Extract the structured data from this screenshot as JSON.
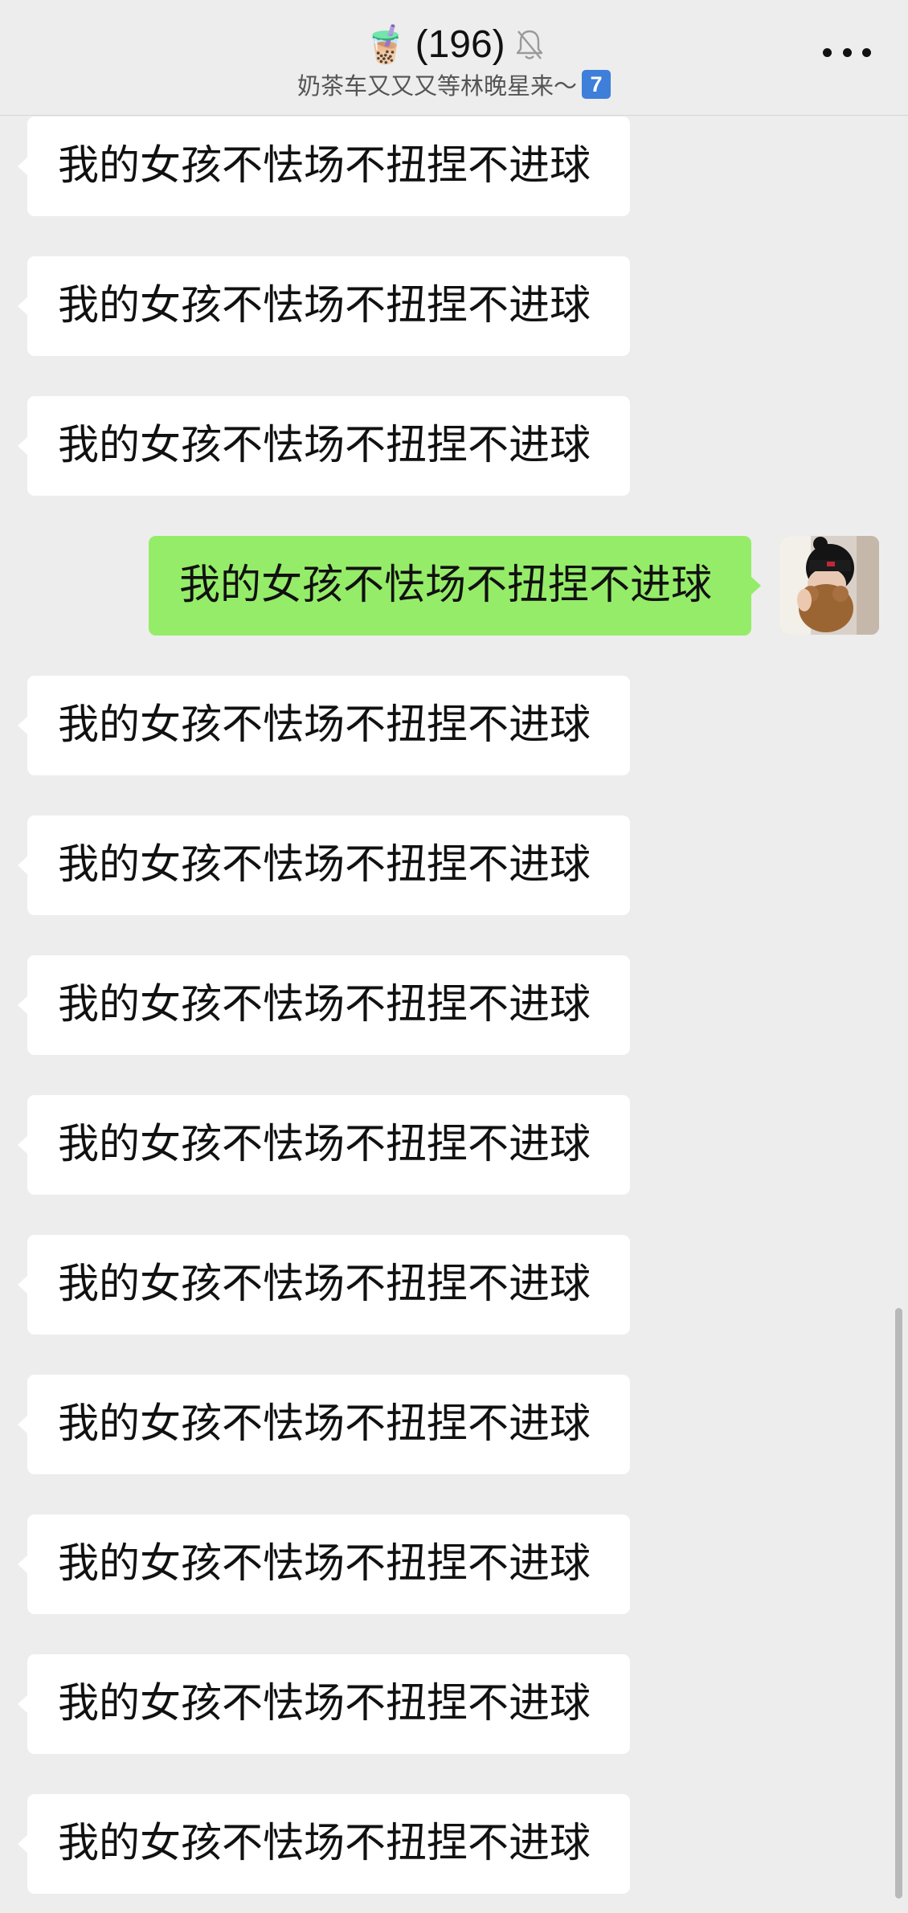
{
  "header": {
    "emoji": "🧋",
    "count": "(196)",
    "subtitle": "奶茶车又又又等林晚星来～",
    "badge": "7"
  },
  "messages": [
    {
      "side": "in",
      "text": "我的女孩不怯场不扭捏不进球"
    },
    {
      "side": "in",
      "text": "我的女孩不怯场不扭捏不进球"
    },
    {
      "side": "in",
      "text": "我的女孩不怯场不扭捏不进球"
    },
    {
      "side": "out",
      "text": "我的女孩不怯场不扭捏不进球"
    },
    {
      "side": "in",
      "text": "我的女孩不怯场不扭捏不进球"
    },
    {
      "side": "in",
      "text": "我的女孩不怯场不扭捏不进球"
    },
    {
      "side": "in",
      "text": "我的女孩不怯场不扭捏不进球"
    },
    {
      "side": "in",
      "text": "我的女孩不怯场不扭捏不进球"
    },
    {
      "side": "in",
      "text": "我的女孩不怯场不扭捏不进球"
    },
    {
      "side": "in",
      "text": "我的女孩不怯场不扭捏不进球"
    },
    {
      "side": "in",
      "text": "我的女孩不怯场不扭捏不进球"
    },
    {
      "side": "in",
      "text": "我的女孩不怯场不扭捏不进球"
    },
    {
      "side": "in",
      "text": "我的女孩不怯场不扭捏不进球"
    }
  ],
  "colors": {
    "background": "#ededed",
    "incoming_bubble": "#ffffff",
    "outgoing_bubble": "#95ec69"
  },
  "icons": {
    "mute": "bell-slash-icon",
    "more": "more-dots-icon"
  }
}
